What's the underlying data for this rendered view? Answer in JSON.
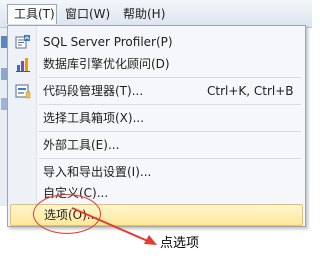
{
  "menubar": {
    "items": [
      {
        "label": "工具(T)",
        "active": true
      },
      {
        "label": "窗口(W)",
        "active": false
      },
      {
        "label": "帮助(H)",
        "active": false
      }
    ]
  },
  "tools_menu": {
    "items": [
      {
        "label": "SQL Server Profiler(P)",
        "icon": "sql-profiler-icon"
      },
      {
        "label": "数据库引擎优化顾问(D)",
        "icon": "tuning-advisor-icon"
      },
      {
        "label": "代码段管理器(T)...",
        "shortcut": "Ctrl+K, Ctrl+B",
        "icon": "code-snippet-icon"
      },
      {
        "label": "选择工具箱项(X)..."
      },
      {
        "label": "外部工具(E)..."
      },
      {
        "label": "导入和导出设置(I)..."
      },
      {
        "label": "自定义(C)..."
      },
      {
        "label": "选项(O)...",
        "highlighted": true
      }
    ]
  },
  "annotation": {
    "text": "点选项",
    "color": "#e03c31"
  },
  "colors": {
    "highlight_top": "#fff6cf",
    "highlight_bottom": "#ffe89a",
    "menu_background": "#f5f7fa"
  }
}
